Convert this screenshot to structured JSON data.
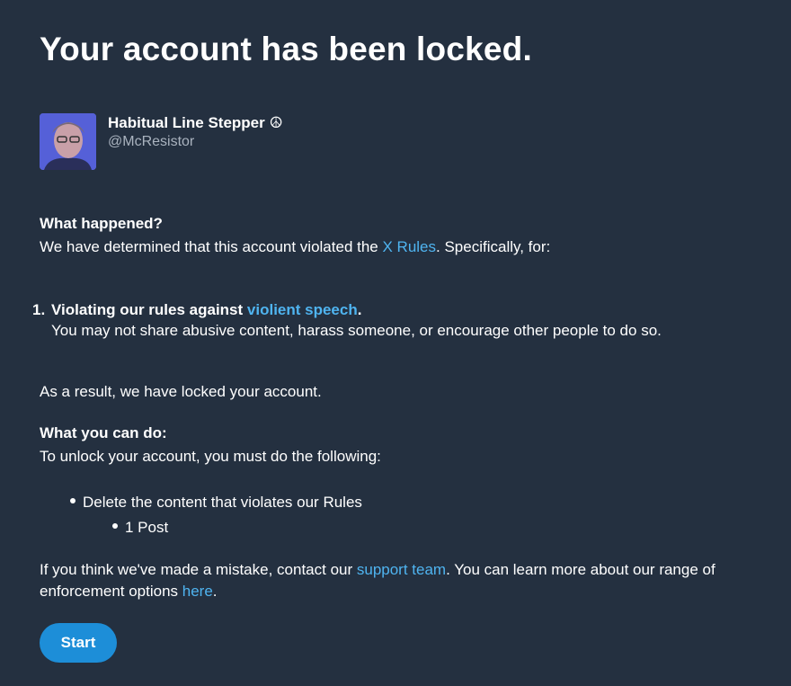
{
  "title": "Your account has been locked.",
  "profile": {
    "display_name": "Habitual Line Stepper",
    "emoji": "☮",
    "handle": "@McResistor"
  },
  "what_happened": {
    "heading": "What happened?",
    "text_before": "We have determined that this account violated the ",
    "link": "X Rules",
    "text_after": ". Specifically, for:"
  },
  "violation": {
    "number": "1.",
    "title_before": "Violating our rules against ",
    "link": "violient speech",
    "title_after": ".",
    "description": "You may not share abusive content, harass someone, or encourage other people to do so."
  },
  "result_text": "As a result, we have locked your account.",
  "what_you_can_do": {
    "heading": "What you can do:",
    "text": "To unlock your account, you must do the following:",
    "items": [
      {
        "label": "Delete the content that violates our Rules",
        "subitems": [
          "1 Post"
        ]
      }
    ]
  },
  "footer": {
    "text1": "If you think we've made a mistake, contact our ",
    "support_link": "support team",
    "text2": ". You can learn more about our range of enforcement options ",
    "here_link": "here",
    "text3": "."
  },
  "button": {
    "label": "Start"
  },
  "colors": {
    "background": "#243040",
    "link": "#4fb4f0",
    "button": "#1d8ed8"
  }
}
